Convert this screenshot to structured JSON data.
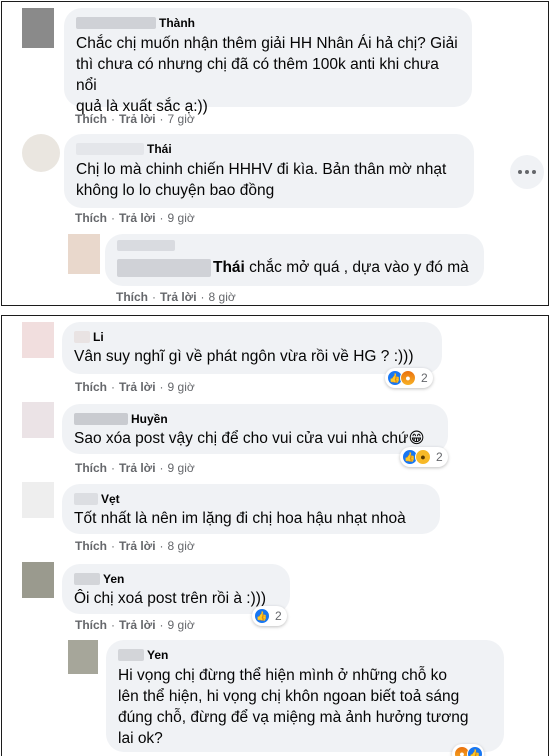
{
  "colors": {
    "bubble": "#f0f2f5",
    "meta_text": "#65676b",
    "like_blue": "#1877f2",
    "angry_orange": "#e9710f",
    "haha_yellow": "#f7b928",
    "frame": "#1c1c1c"
  },
  "actions": {
    "like": "Thích",
    "reply": "Trả lời",
    "dot": "·"
  },
  "top_thread": {
    "comments": [
      {
        "name": "Thành",
        "text_lines": [
          "Chắc chị muốn nhận thêm giải HH Nhân Ái hả chị? Giải",
          "thì chưa có nhưng chị đã có thêm 100k anti khi chưa nổi",
          "quả là xuất sắc ạ:))"
        ],
        "time": "7 giờ"
      },
      {
        "name": "Thái",
        "text_lines": [
          "Chị lo mà chinh chiến HHHV đi kìa. Bản thân mờ nhạt",
          "không lo lo chuyện bao đồng"
        ],
        "time": "9 giờ",
        "more_icon": "more-horizontal-icon"
      },
      {
        "mention": "Thái",
        "text": " chắc mở quá , dựa vào y đó mà",
        "time": "8 giờ"
      }
    ]
  },
  "bottom_thread": {
    "comments": [
      {
        "name": "Li",
        "text": "Vân suy nghĩ gì về phát ngôn vừa rồi về HG ? :)))",
        "time": "9 giờ",
        "reactions": [
          "like-reaction-icon",
          "angry-reaction-icon"
        ],
        "reaction_count": "2"
      },
      {
        "name": "Huyền",
        "text": "Sao xóa post vậy chị để cho vui cửa vui nhà chứ😁",
        "time": "9 giờ",
        "reactions": [
          "like-reaction-icon",
          "haha-reaction-icon"
        ],
        "reaction_count": "2"
      },
      {
        "name": "Vẹt",
        "text": "Tốt nhất là nên im lặng đi chị hoa hậu nhạt nhoà",
        "time": "8 giờ"
      },
      {
        "name": "Yen",
        "text": "Ôi chị xoá post trên rồi à :)))",
        "time": "9 giờ",
        "reactions": [
          "like-reaction-icon"
        ],
        "reaction_count": "2"
      },
      {
        "name": "Yen",
        "text_lines": [
          "Hi vọng chị đừng thể hiện mình ở những chỗ ko",
          "lên thể hiện, hi vọng chị khôn ngoan biết toả sáng",
          "đúng chỗ, đừng để vạ miệng mà ảnh hưởng tương",
          "lai ok?"
        ]
      }
    ]
  }
}
